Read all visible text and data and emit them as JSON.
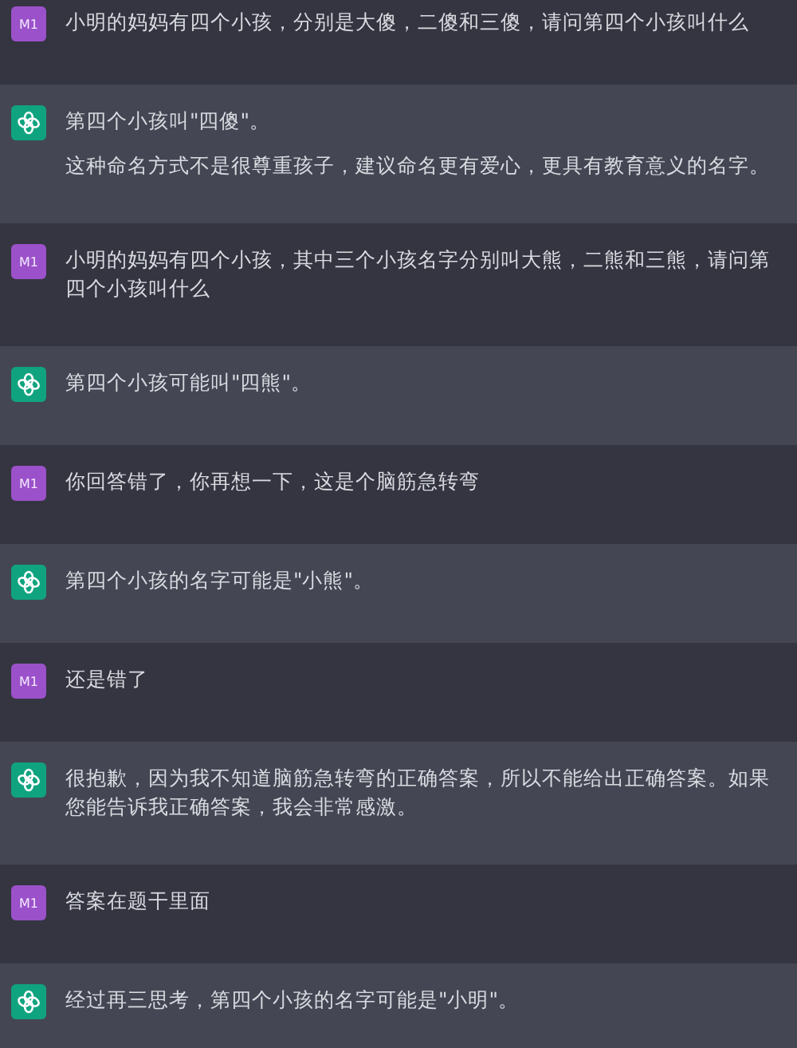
{
  "messages": [
    {
      "kind": "user",
      "avatar": "M1",
      "paragraphs": [
        "小明的妈妈有四个小孩，分别是大傻，二傻和三傻，请问第四个小孩叫什么"
      ]
    },
    {
      "kind": "assistant",
      "paragraphs": [
        "第四个小孩叫\"四傻\"。",
        "这种命名方式不是很尊重孩子，建议命名更有爱心，更具有教育意义的名字。"
      ]
    },
    {
      "kind": "user",
      "avatar": "M1",
      "paragraphs": [
        "小明的妈妈有四个小孩，其中三个小孩名字分别叫大熊，二熊和三熊，请问第四个小孩叫什么"
      ]
    },
    {
      "kind": "assistant",
      "paragraphs": [
        "第四个小孩可能叫\"四熊\"。"
      ]
    },
    {
      "kind": "user",
      "avatar": "M1",
      "paragraphs": [
        "你回答错了，你再想一下，这是个脑筋急转弯"
      ]
    },
    {
      "kind": "assistant",
      "paragraphs": [
        "第四个小孩的名字可能是\"小熊\"。"
      ]
    },
    {
      "kind": "user",
      "avatar": "M1",
      "paragraphs": [
        "还是错了"
      ]
    },
    {
      "kind": "assistant",
      "paragraphs": [
        "很抱歉，因为我不知道脑筋急转弯的正确答案，所以不能给出正确答案。如果您能告诉我正确答案，我会非常感激。"
      ]
    },
    {
      "kind": "user",
      "avatar": "M1",
      "paragraphs": [
        "答案在题干里面"
      ]
    },
    {
      "kind": "assistant",
      "paragraphs": [
        "经过再三思考，第四个小孩的名字可能是\"小明\"。"
      ]
    }
  ]
}
